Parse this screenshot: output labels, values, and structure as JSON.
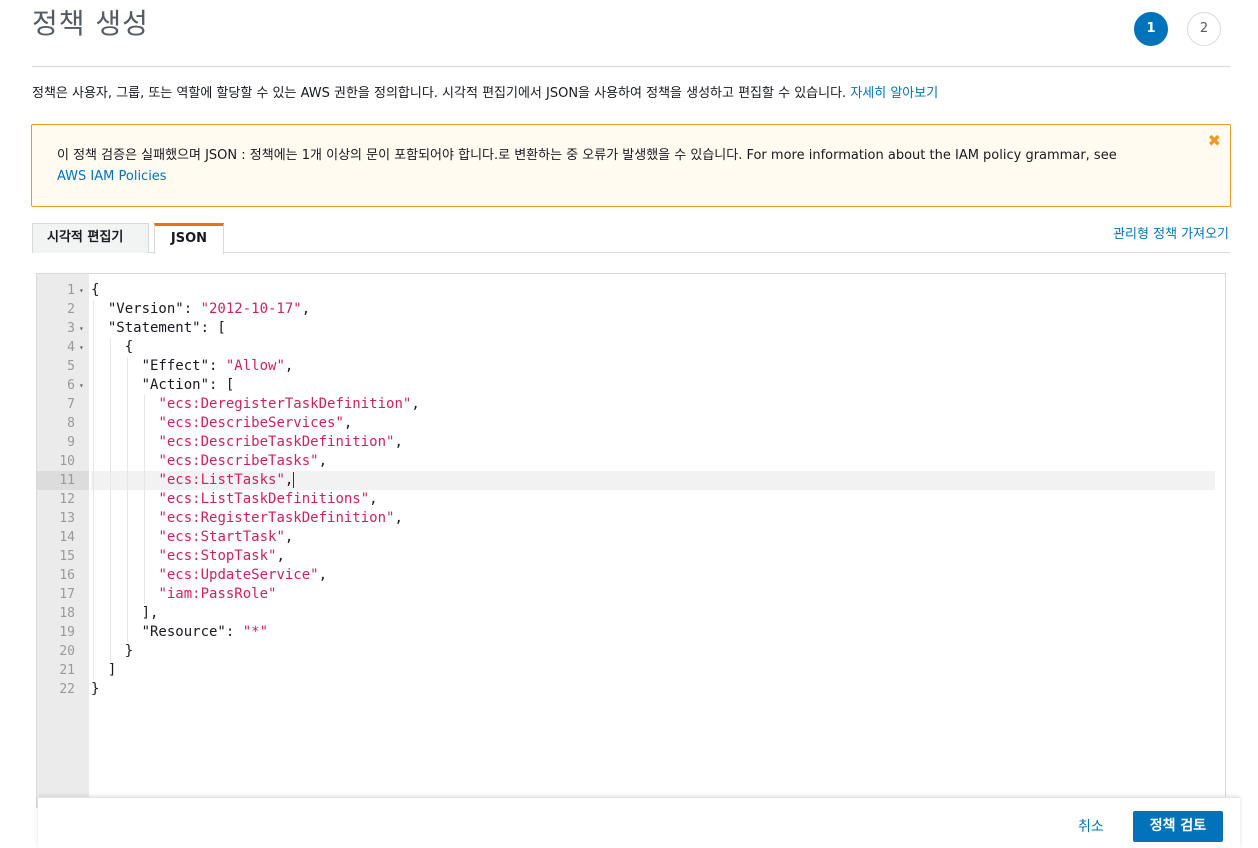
{
  "page": {
    "title": "정책 생성",
    "steps": [
      "1",
      "2"
    ],
    "intro": "정책은 사용자, 그룹, 또는 역할에 할당할 수 있는 AWS 권한을 정의합니다. 시각적 편집기에서 JSON을 사용하여 정책을 생성하고 편집할 수 있습니다.",
    "intro_link": "자세히 알아보기"
  },
  "warning": {
    "message": "이 정책 검증은 실패했으며 JSON : 정책에는 1개 이상의 문이 포함되어야 합니다.로 변환하는 중 오류가 발생했을 수 있습니다. For more information about the IAM policy grammar, see",
    "link": "AWS IAM Policies",
    "close_icon": "✖"
  },
  "tabs": {
    "visual": "시각적 편집기",
    "json": "JSON",
    "import_link": "관리형 정책 가져오기"
  },
  "editor": {
    "active_line": 11,
    "lines": [
      "{",
      "  \"Version\": \"2012-10-17\",",
      "  \"Statement\": [",
      "    {",
      "      \"Effect\": \"Allow\",",
      "      \"Action\": [",
      "        \"ecs:DeregisterTaskDefinition\",",
      "        \"ecs:DescribeServices\",",
      "        \"ecs:DescribeTaskDefinition\",",
      "        \"ecs:DescribeTasks\",",
      "        \"ecs:ListTasks\",",
      "        \"ecs:ListTaskDefinitions\",",
      "        \"ecs:RegisterTaskDefinition\",",
      "        \"ecs:StartTask\",",
      "        \"ecs:StopTask\",",
      "        \"ecs:UpdateService\",",
      "        \"iam:PassRole\"",
      "      ],",
      "      \"Resource\": \"*\"",
      "    }",
      "  ]",
      "}"
    ],
    "foldable_lines": [
      1,
      3,
      4,
      6
    ]
  },
  "footer": {
    "cancel": "취소",
    "review": "정책 검토"
  },
  "colors": {
    "primary": "#0073bb",
    "warning_border": "#eb9a27",
    "tab_accent": "#ec7211",
    "string": "#d0215b"
  }
}
